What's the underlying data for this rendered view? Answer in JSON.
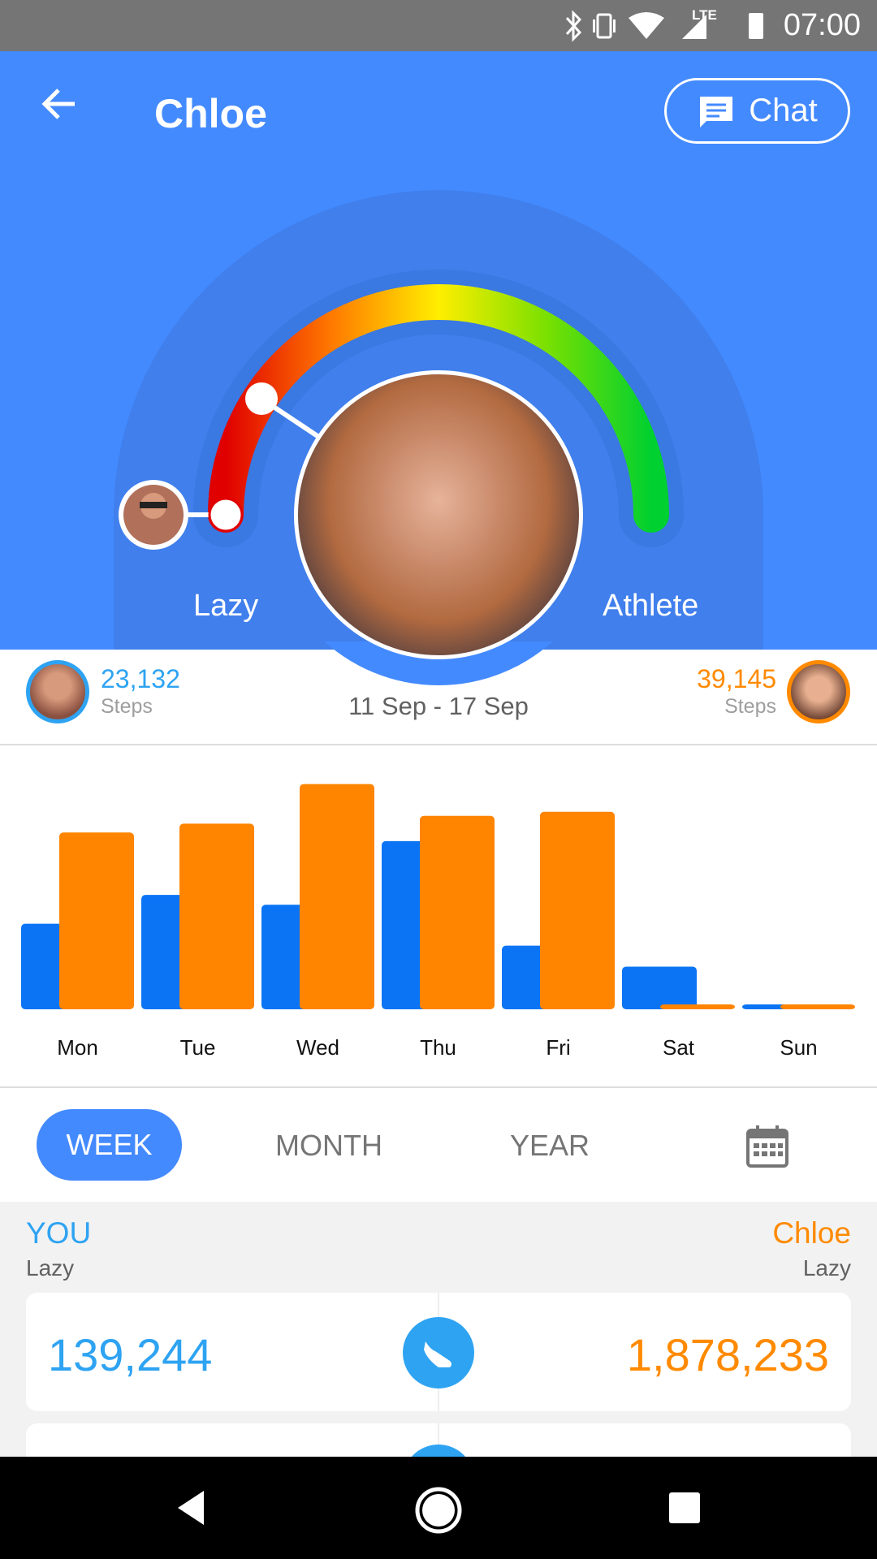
{
  "status_bar": {
    "time": "07:00",
    "icons": [
      "bluetooth-icon",
      "vibrate-icon",
      "wifi-icon",
      "lte-signal-icon",
      "battery-icon"
    ],
    "network": "LTE"
  },
  "header": {
    "title": "Chloe",
    "chat_label": "Chat",
    "back_icon": "arrow-left-icon",
    "chat_icon": "message-icon"
  },
  "gauge": {
    "min_label": "Lazy",
    "max_label": "Athlete",
    "colors": [
      "#E00000",
      "#FF7A00",
      "#FFEE00",
      "#7CE000",
      "#00D030"
    ]
  },
  "summary": {
    "you_steps": "23,132",
    "you_label": "Steps",
    "friend_steps": "39,145",
    "friend_label": "Steps",
    "date_range": "11 Sep - 17 Sep"
  },
  "chart_data": {
    "type": "bar",
    "categories": [
      "Mon",
      "Tue",
      "Wed",
      "Thu",
      "Fri",
      "Sat",
      "Sun"
    ],
    "series": [
      {
        "values": [
          3390,
          4530,
          4140,
          6660,
          2520,
          1690,
          0
        ],
        "color": "#0A74F5"
      },
      {
        "values": [
          7000,
          7350,
          8920,
          7660,
          7820,
          0,
          0
        ],
        "color": "#FF8400"
      }
    ],
    "ylim": [
      0,
      10000
    ],
    "grid": false
  },
  "tabs": {
    "items": [
      "WEEK",
      "MONTH",
      "YEAR"
    ],
    "active": "WEEK",
    "calendar_icon": "calendar-icon"
  },
  "comparison": {
    "you_name": "YOU",
    "you_level": "Lazy",
    "friend_name": "Chloe",
    "friend_level": "Lazy",
    "you_total": "139,244",
    "friend_total": "1,878,233",
    "icon": "shoe-icon"
  },
  "colors": {
    "header": "#448AFF",
    "you": "#2EA3F2",
    "friend": "#FF8A00"
  }
}
